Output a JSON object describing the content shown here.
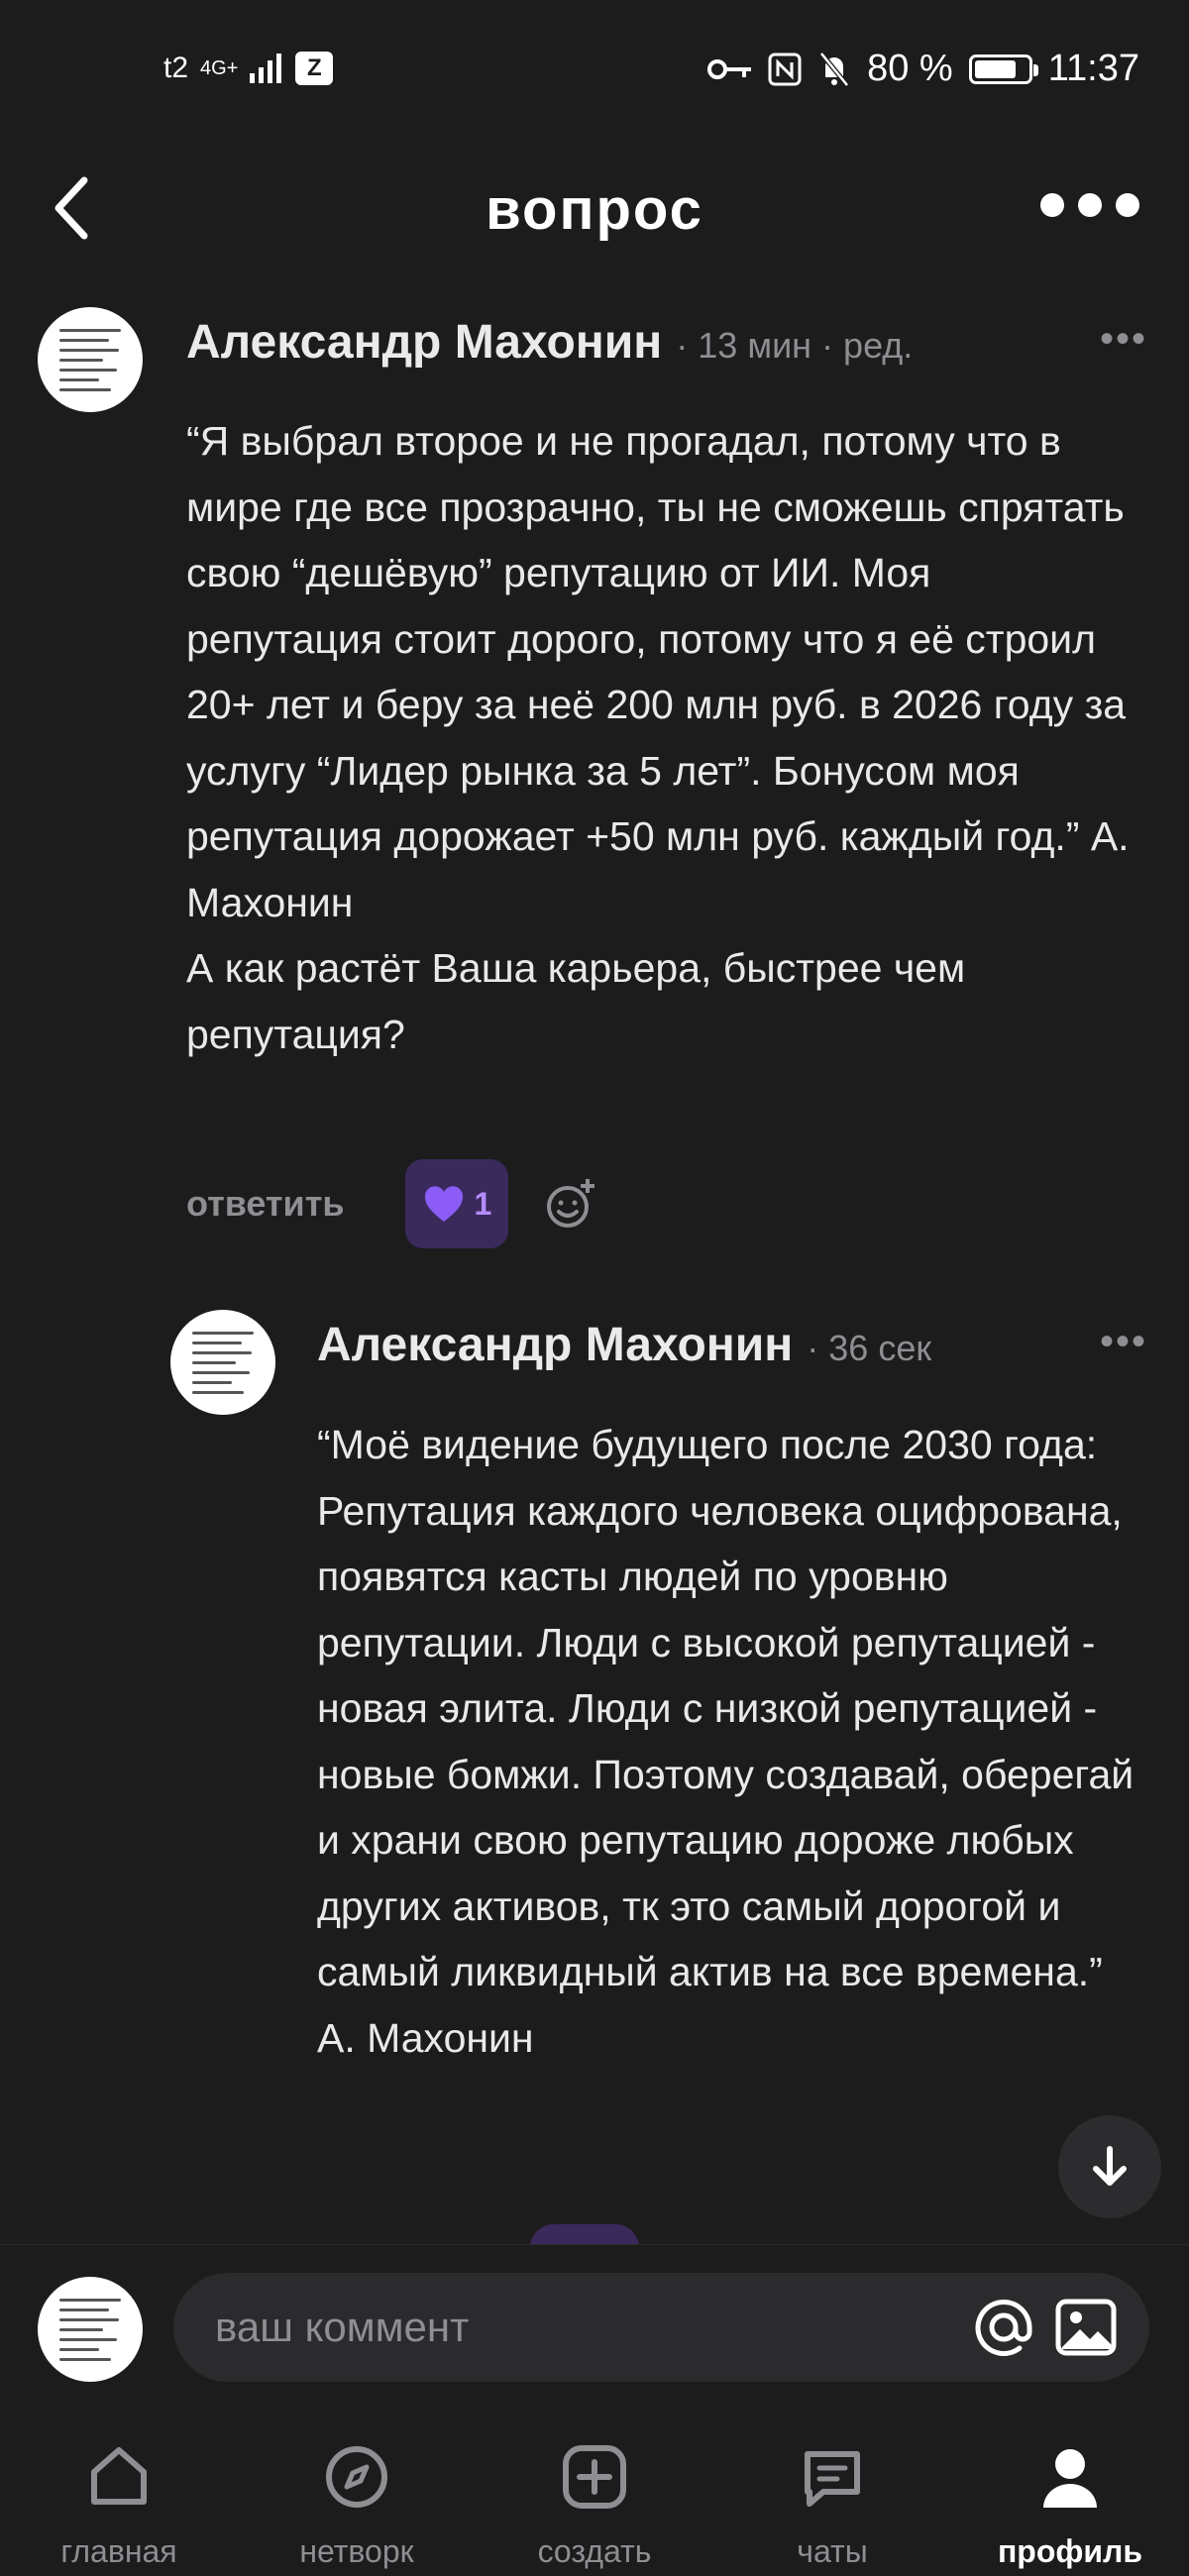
{
  "status_bar": {
    "carrier": "t2",
    "network": "4G+",
    "battery": "80 %",
    "battery_level": 0.8,
    "time": "11:37"
  },
  "header": {
    "title": "вопрос"
  },
  "comments": [
    {
      "author": "Александр Махонин",
      "meta": "· 13 мин · ред.",
      "paragraphs": [
        "“Я выбрал второе и не прогадал, потому что в мире где все прозрачно, ты не сможешь спрятать свою “дешёвую” репутацию от ИИ. Моя репутация стоит дорого, потому что я её строил 20+ лет и беру за неё 200 млн руб. в 2026 году за услугу “Лидер рынка за 5 лет”. Бонусом моя репутация дорожает +50 млн руб. каждый год.” А. Махонин",
        "А как растёт Ваша карьера, быстрее чем репутация?"
      ],
      "reply_label": "ответить",
      "likes": "1"
    },
    {
      "author": "Александр Махонин",
      "meta": "· 36 сек",
      "paragraphs": [
        "“Моё видение будущего после 2030 года:",
        "Репутация каждого человека оцифрована, появятся касты людей по уровню репутации. Люди с высокой репутацией - новая элита. Люди с низкой репутацией - новые бомжи. Поэтому создавай, оберегай и храни свою репутацию дороже любых других активов, тк это самый дорогой и самый ликвидный актив на все времена.” А. Махонин"
      ]
    }
  ],
  "composer": {
    "placeholder": "ваш коммент"
  },
  "nav": [
    {
      "label": "главная",
      "icon": "home-icon"
    },
    {
      "label": "нетворк",
      "icon": "compass-icon"
    },
    {
      "label": "создать",
      "icon": "plus-square-icon"
    },
    {
      "label": "чаты",
      "icon": "chat-icon"
    },
    {
      "label": "профиль",
      "icon": "person-icon",
      "active": true
    }
  ],
  "colors": {
    "background": "#1c1c1d",
    "accent": "#8b5cf6",
    "muted": "#8e8e93"
  }
}
